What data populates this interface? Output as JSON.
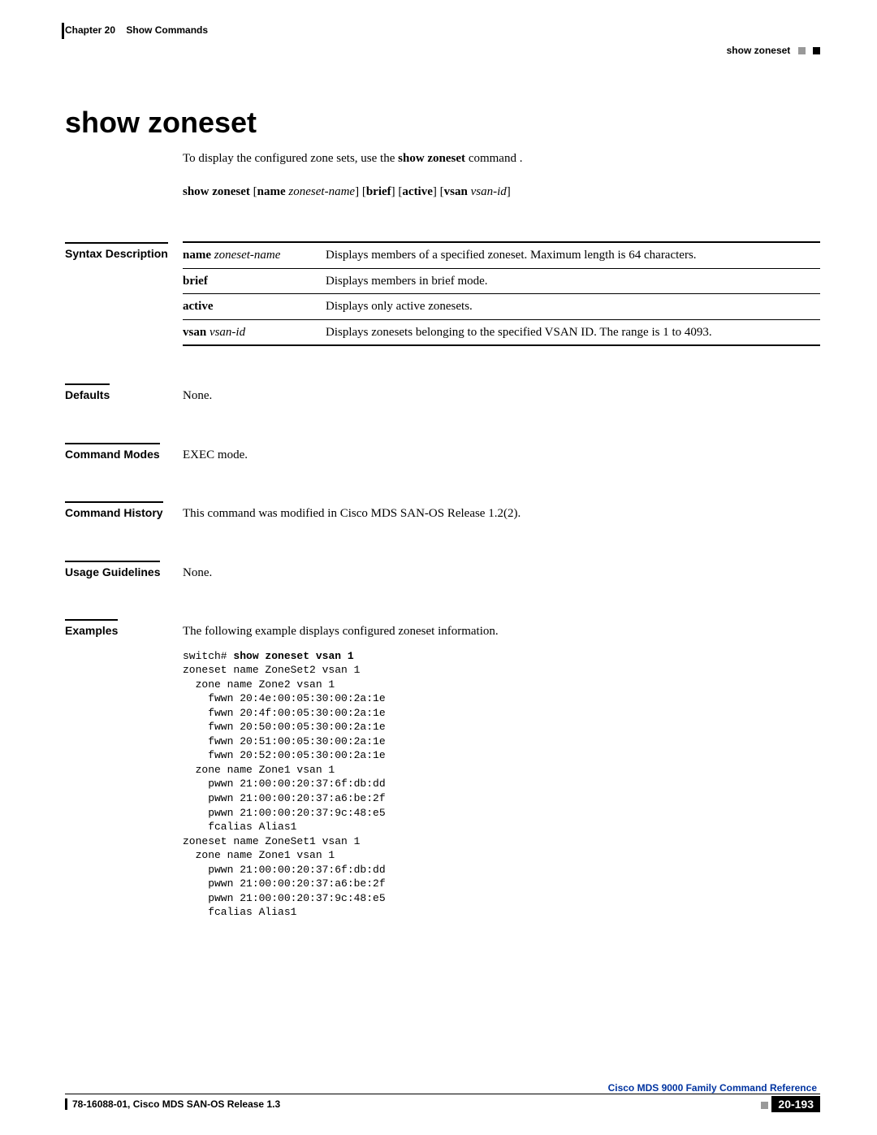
{
  "header": {
    "chapter_label": "Chapter 20",
    "chapter_title": "Show Commands",
    "section_name": "show zoneset"
  },
  "title": "show zoneset",
  "intro_pre": "To display the configured zone sets, use the ",
  "intro_cmd": "show zoneset",
  "intro_post": " command .",
  "syntax_parts": {
    "p1": "show zoneset",
    "p2": "[",
    "p3": "name",
    "p4": "zoneset-name",
    "p5": "] [",
    "p6": "brief",
    "p7": "] [",
    "p8": "active",
    "p9": "] [",
    "p10": "vsan",
    "p11": "vsan-id",
    "p12": "]"
  },
  "sections": {
    "syntax_desc_label": "Syntax Description",
    "defaults_label": "Defaults",
    "defaults_value": "None.",
    "modes_label": "Command Modes",
    "modes_value": "EXEC mode.",
    "history_label": "Command History",
    "history_value": "This command was modified in Cisco MDS SAN-OS Release 1.2(2).",
    "usage_label": "Usage Guidelines",
    "usage_value": "None.",
    "examples_label": "Examples",
    "examples_intro": "The following example displays configured zoneset information."
  },
  "syntax_table": [
    {
      "kw": "name",
      "kw_ital": "zoneset-name",
      "desc": "Displays members of a specified zoneset. Maximum length is 64 characters."
    },
    {
      "kw": "brief",
      "kw_ital": "",
      "desc": "Displays members in brief mode."
    },
    {
      "kw": "active",
      "kw_ital": "",
      "desc": "Displays only active zonesets."
    },
    {
      "kw": "vsan",
      "kw_ital": "vsan-id",
      "desc": "Displays zonesets belonging to the specified VSAN ID. The range is 1 to 4093."
    }
  ],
  "example": {
    "prompt": "switch# ",
    "command": "show zoneset vsan 1",
    "output": "zoneset name ZoneSet2 vsan 1\n  zone name Zone2 vsan 1\n    fwwn 20:4e:00:05:30:00:2a:1e\n    fwwn 20:4f:00:05:30:00:2a:1e\n    fwwn 20:50:00:05:30:00:2a:1e\n    fwwn 20:51:00:05:30:00:2a:1e\n    fwwn 20:52:00:05:30:00:2a:1e\n  zone name Zone1 vsan 1\n    pwwn 21:00:00:20:37:6f:db:dd\n    pwwn 21:00:00:20:37:a6:be:2f\n    pwwn 21:00:00:20:37:9c:48:e5\n    fcalias Alias1\nzoneset name ZoneSet1 vsan 1\n  zone name Zone1 vsan 1\n    pwwn 21:00:00:20:37:6f:db:dd\n    pwwn 21:00:00:20:37:a6:be:2f\n    pwwn 21:00:00:20:37:9c:48:e5\n    fcalias Alias1"
  },
  "footer": {
    "book": "Cisco MDS 9000 Family Command Reference",
    "doc": "78-16088-01, Cisco MDS SAN-OS Release 1.3",
    "page": "20-193"
  }
}
